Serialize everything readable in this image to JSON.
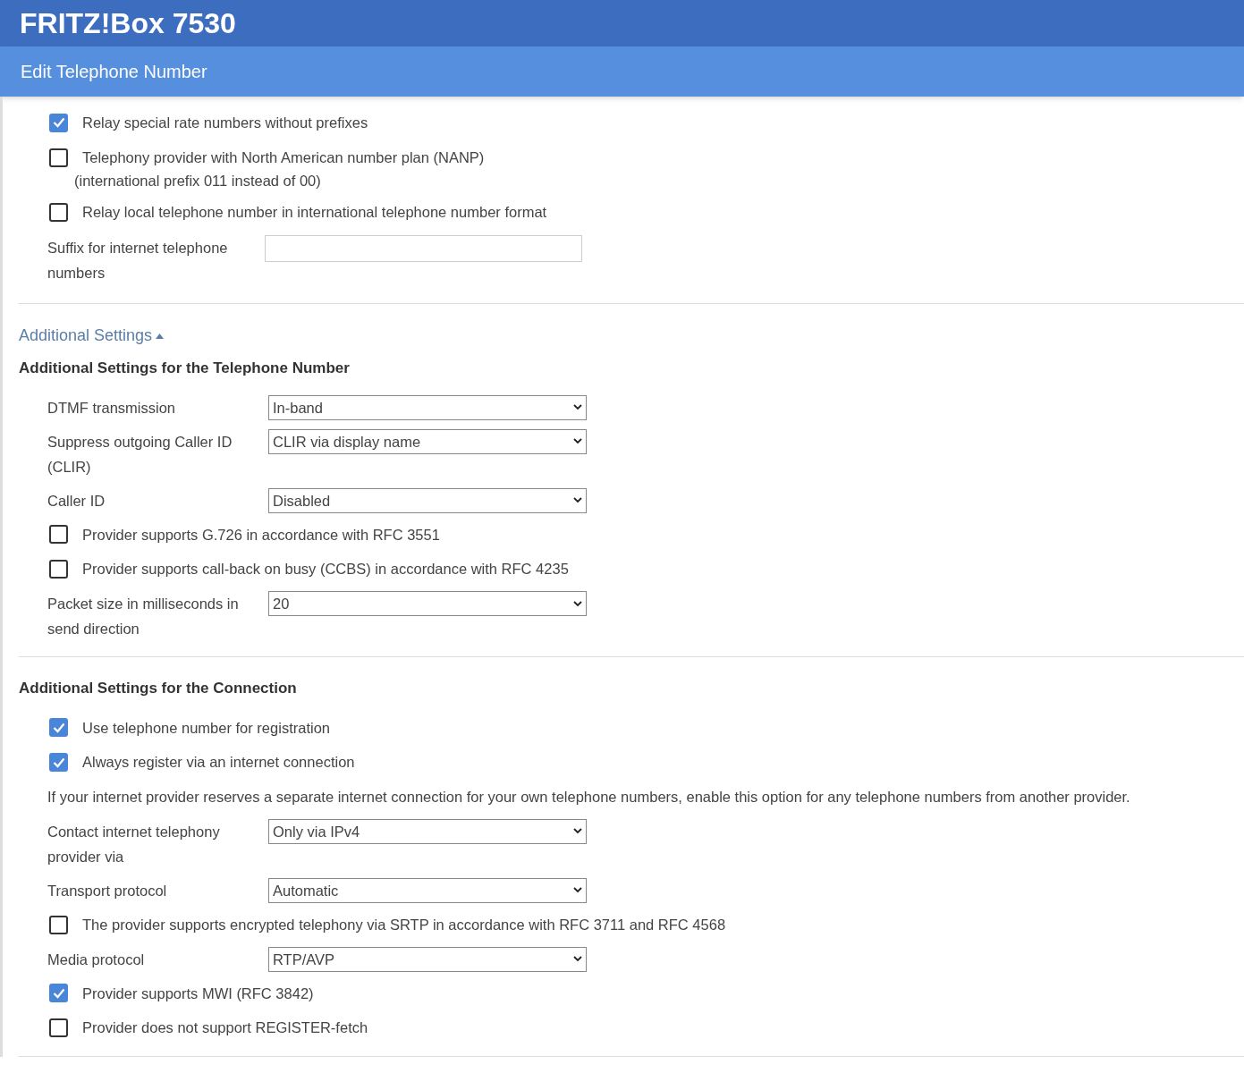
{
  "header": {
    "title": "FRITZ!Box 7530"
  },
  "page_title": "Edit Telephone Number",
  "sections": [
    {
      "items": [
        {
          "kind": "checkbox",
          "label": "Relay special rate numbers without prefixes",
          "checked": true
        },
        {
          "kind": "checkbox",
          "label": "Telephony provider with North American number plan (NANP)",
          "checked": false
        },
        {
          "kind": "note",
          "text": "(international prefix 011 instead of 00)"
        },
        {
          "kind": "checkbox",
          "label": "Relay local telephone number in international telephone number format",
          "checked": false
        },
        {
          "kind": "text_field",
          "label": "Suffix for internet telephone numbers"
        }
      ]
    },
    {
      "toggle": {
        "label": "Additional Settings",
        "expanded": true
      },
      "heading": "Additional Settings for the Telephone Number",
      "items": [
        {
          "kind": "select",
          "label": "DTMF transmission",
          "value": "In-band"
        },
        {
          "kind": "select",
          "label": "Suppress outgoing Caller ID (CLIR)",
          "value": "CLIR via display name"
        },
        {
          "kind": "select",
          "label": "Caller ID",
          "value": "Disabled"
        },
        {
          "kind": "checkbox",
          "label": "Provider supports G.726 in accordance with RFC 3551",
          "checked": false
        },
        {
          "kind": "checkbox",
          "label": "Provider supports call-back on busy (CCBS) in accordance with RFC 4235",
          "checked": false
        },
        {
          "kind": "select",
          "label": "Packet size in milliseconds in send direction",
          "value": "20"
        }
      ]
    },
    {
      "heading": "Additional Settings for the Connection",
      "items": [
        {
          "kind": "checkbox",
          "label": "Use telephone number for registration",
          "checked": true
        },
        {
          "kind": "checkbox",
          "label": "Always register via an internet connection",
          "checked": true
        },
        {
          "kind": "paragraph",
          "text": "If your internet provider reserves a separate internet connection for your own telephone numbers, enable this option for any telephone numbers from another provider."
        },
        {
          "kind": "select",
          "label": "Contact internet telephony provider via",
          "value": "Only via IPv4"
        },
        {
          "kind": "select",
          "label": "Transport protocol",
          "value": "Automatic"
        },
        {
          "kind": "checkbox",
          "label": "The provider supports encrypted telephony via SRTP in accordance with RFC 3711 and RFC 4568",
          "checked": false
        },
        {
          "kind": "select",
          "label": "Media protocol",
          "value": "RTP/AVP"
        },
        {
          "kind": "checkbox",
          "label": "Provider supports MWI (RFC 3842)",
          "checked": true
        },
        {
          "kind": "checkbox",
          "label": "Provider does not support REGISTER-fetch",
          "checked": false
        }
      ]
    }
  ]
}
